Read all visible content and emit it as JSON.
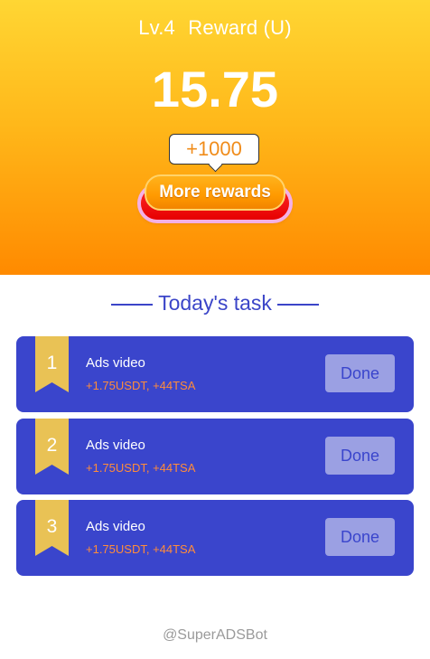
{
  "header": {
    "level": "Lv.4",
    "reward_label": "Reward (U)",
    "amount": "15.75",
    "bonus_bubble": "+1000",
    "more_rewards_label": "More rewards"
  },
  "tasks_section": {
    "title": "Today's task"
  },
  "tasks": [
    {
      "number": "1",
      "name": "Ads video",
      "reward": "+1.75USDT, +44TSA",
      "button": "Done"
    },
    {
      "number": "2",
      "name": "Ads video",
      "reward": "+1.75USDT, +44TSA",
      "button": "Done"
    },
    {
      "number": "3",
      "name": "Ads video",
      "reward": "+1.75USDT, +44TSA",
      "button": "Done"
    }
  ],
  "footer": {
    "handle": "@SuperADSBot"
  },
  "colors": {
    "accent_blue": "#3a45cc",
    "reward_orange": "#ff8c3a",
    "hero_gradient_top": "#ffd633",
    "hero_gradient_bottom": "#ff8a00",
    "done_button": "#9ba0e3",
    "ribbon_gold": "#e9c255"
  }
}
